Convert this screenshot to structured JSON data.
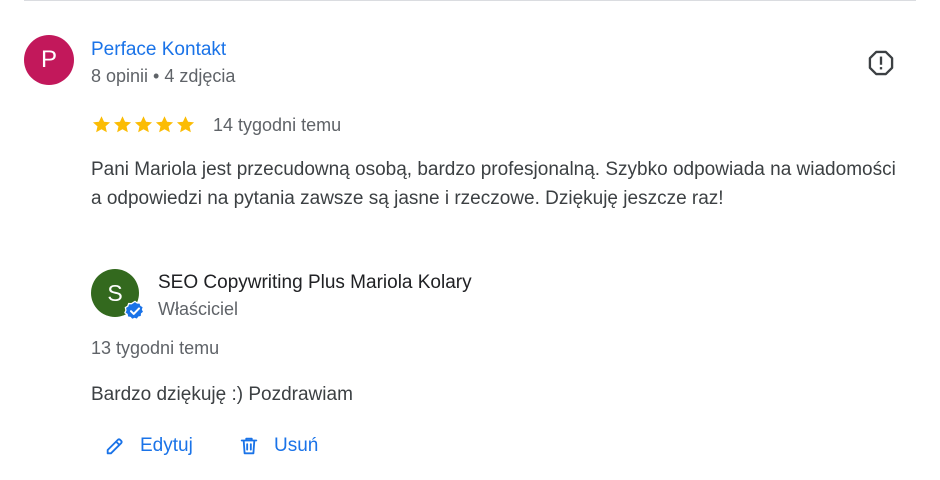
{
  "review": {
    "avatar_letter": "P",
    "reviewer_name": "Perface Kontakt",
    "reviewer_meta": "8 opinii • 4 zdjęcia",
    "rating": 5,
    "date": "14 tygodni temu",
    "text": "Pani Mariola jest przecudowną osobą, bardzo profesjonalną. Szybko odpowiada na wiadomości a odpowiedzi na pytania zawsze są jasne i rzeczowe. Dziękuję jeszcze raz!",
    "report_icon": "report-flag-icon"
  },
  "owner_reply": {
    "avatar_letter": "S",
    "name": "SEO Copywriting Plus Mariola Kolary",
    "role": "Właściciel",
    "date": "13 tygodni temu",
    "text": "Bardzo dziękuję :) Pozdrawiam",
    "verified_icon": "verified-check-icon"
  },
  "actions": {
    "edit_label": "Edytuj",
    "delete_label": "Usuń",
    "edit_icon": "pencil-icon",
    "delete_icon": "trash-icon"
  },
  "colors": {
    "link": "#1a73e8",
    "star": "#fbbc04",
    "reviewer_avatar": "#c2185b",
    "owner_avatar": "#33691e",
    "text": "#3c4043",
    "muted": "#5f6368"
  }
}
